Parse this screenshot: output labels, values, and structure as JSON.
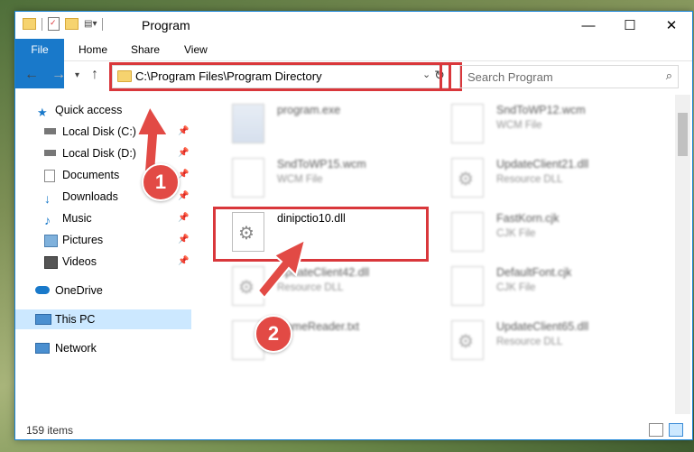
{
  "window": {
    "title": "Program",
    "controls": {
      "minimize": "—",
      "maximize": "☐",
      "close": "✕"
    }
  },
  "ribbon": {
    "tabs": [
      {
        "label": "File"
      },
      {
        "label": "Home"
      },
      {
        "label": "Share"
      },
      {
        "label": "View"
      }
    ]
  },
  "navigation": {
    "address": "C:\\Program Files\\Program Directory",
    "search_placeholder": "Search Program",
    "icons": {
      "back": "←",
      "forward": "→",
      "recent": "▾",
      "up": "↑",
      "dropdown": "⌄",
      "refresh": "↻",
      "search": "⌕"
    }
  },
  "sidebar": {
    "items": [
      {
        "label": "Quick access",
        "icon": "star-icon",
        "pinned": false
      },
      {
        "label": "Local Disk (C:)",
        "icon": "drive-icon",
        "pinned": true
      },
      {
        "label": "Local Disk (D:)",
        "icon": "drive-icon",
        "pinned": true
      },
      {
        "label": "Documents",
        "icon": "documents-icon",
        "pinned": true
      },
      {
        "label": "Downloads",
        "icon": "download-icon",
        "pinned": true
      },
      {
        "label": "Music",
        "icon": "music-icon",
        "pinned": true
      },
      {
        "label": "Pictures",
        "icon": "pictures-icon",
        "pinned": true
      },
      {
        "label": "Videos",
        "icon": "videos-icon",
        "pinned": true
      },
      {
        "label": "OneDrive",
        "icon": "cloud-icon",
        "pinned": false
      },
      {
        "label": "This PC",
        "icon": "pc-icon",
        "pinned": false,
        "selected": true
      },
      {
        "label": "Network",
        "icon": "network-icon",
        "pinned": false
      }
    ]
  },
  "files": [
    {
      "name": "program.exe",
      "type": "",
      "icon": "exe-icon"
    },
    {
      "name": "SndToWP12.wcm",
      "type": "WCM File",
      "icon": "file-icon"
    },
    {
      "name": "SndToWP15.wcm",
      "type": "WCM File",
      "icon": "file-icon"
    },
    {
      "name": "UpdateClient21.dll",
      "type": "Resource DLL",
      "icon": "dll-icon"
    },
    {
      "name": "dinipctio10.dll",
      "type": "",
      "icon": "dll-icon"
    },
    {
      "name": "FastKorn.cjk",
      "type": "CJK File",
      "icon": "file-icon"
    },
    {
      "name": "UpdateClient42.dll",
      "type": "Resource DLL",
      "icon": "dll-icon"
    },
    {
      "name": "DefaultFont.cjk",
      "type": "CJK File",
      "icon": "file-icon"
    },
    {
      "name": "GameReader.txt",
      "type": "",
      "icon": "file-icon"
    },
    {
      "name": "UpdateClient65.dll",
      "type": "Resource DLL",
      "icon": "dll-icon"
    }
  ],
  "status": {
    "item_count": "159 items"
  },
  "annotations": {
    "badge1": "1",
    "badge2": "2"
  },
  "colors": {
    "accent": "#1979ca",
    "highlight": "#d9373b",
    "selection": "#cce8ff"
  }
}
